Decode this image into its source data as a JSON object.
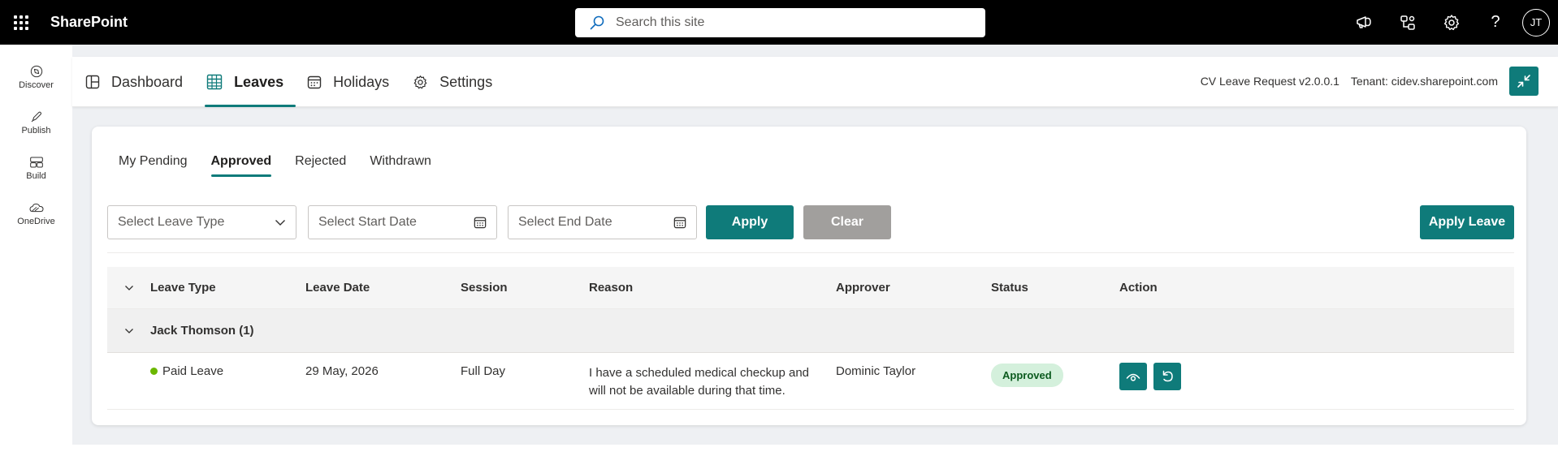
{
  "suite": {
    "brand": "SharePoint",
    "search_placeholder": "Search this site",
    "avatar_initials": "JT"
  },
  "appbar": {
    "items": [
      {
        "label": "Discover",
        "icon": "discover-icon"
      },
      {
        "label": "Publish",
        "icon": "publish-icon"
      },
      {
        "label": "Build",
        "icon": "build-icon"
      },
      {
        "label": "OneDrive",
        "icon": "onedrive-icon"
      }
    ]
  },
  "nav": {
    "tabs": [
      {
        "label": "Dashboard",
        "icon": "dashboard-icon"
      },
      {
        "label": "Leaves",
        "icon": "table-icon",
        "active": true
      },
      {
        "label": "Holidays",
        "icon": "calendar-icon"
      },
      {
        "label": "Settings",
        "icon": "gear-icon"
      }
    ],
    "version": "CV Leave Request v2.0.0.1",
    "tenant": "Tenant: cidev.sharepoint.com"
  },
  "subtabs": [
    {
      "label": "My Pending"
    },
    {
      "label": "Approved",
      "active": true
    },
    {
      "label": "Rejected"
    },
    {
      "label": "Withdrawn"
    }
  ],
  "filters": {
    "leave_type_placeholder": "Select Leave Type",
    "start_date_placeholder": "Select Start Date",
    "end_date_placeholder": "Select End Date",
    "apply_label": "Apply",
    "clear_label": "Clear",
    "apply_leave_label": "Apply Leave"
  },
  "table": {
    "headers": {
      "leave_type": "Leave Type",
      "leave_date": "Leave Date",
      "session": "Session",
      "reason": "Reason",
      "approver": "Approver",
      "status": "Status",
      "action": "Action"
    },
    "group": {
      "label": "Jack Thomson (1)"
    },
    "rows": [
      {
        "leave_type": "Paid Leave",
        "leave_date": "29 May, 2026",
        "session": "Full Day",
        "reason": "I have a scheduled medical checkup and will not be available during that time.",
        "approver": "Dominic Taylor",
        "status": "Approved"
      }
    ]
  },
  "colors": {
    "accent": "#0f7b7a",
    "status_approved_bg": "#d4f0dc",
    "leave_dot": "#6bb700"
  }
}
